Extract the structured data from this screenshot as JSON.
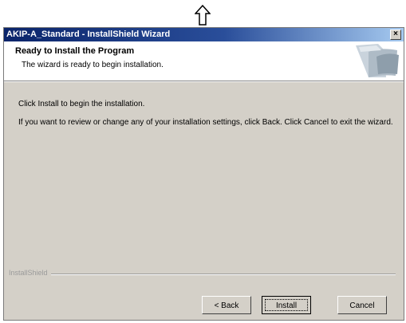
{
  "window": {
    "title": "AKIP-A_Standard - InstallShield Wizard",
    "close_glyph": "×"
  },
  "header": {
    "title": "Ready to Install the Program",
    "subtitle": "The wizard is ready to begin installation."
  },
  "body": {
    "line1": "Click Install to begin the installation.",
    "line2": "If you want to review or change any of your installation settings, click Back. Click Cancel to exit the wizard."
  },
  "footer": {
    "brand": "InstallShield"
  },
  "buttons": {
    "back": "< Back",
    "install": "Install",
    "cancel": "Cancel"
  },
  "icons": {
    "arrow": "up-arrow-icon",
    "graphic": "installer-graphic-icon"
  }
}
